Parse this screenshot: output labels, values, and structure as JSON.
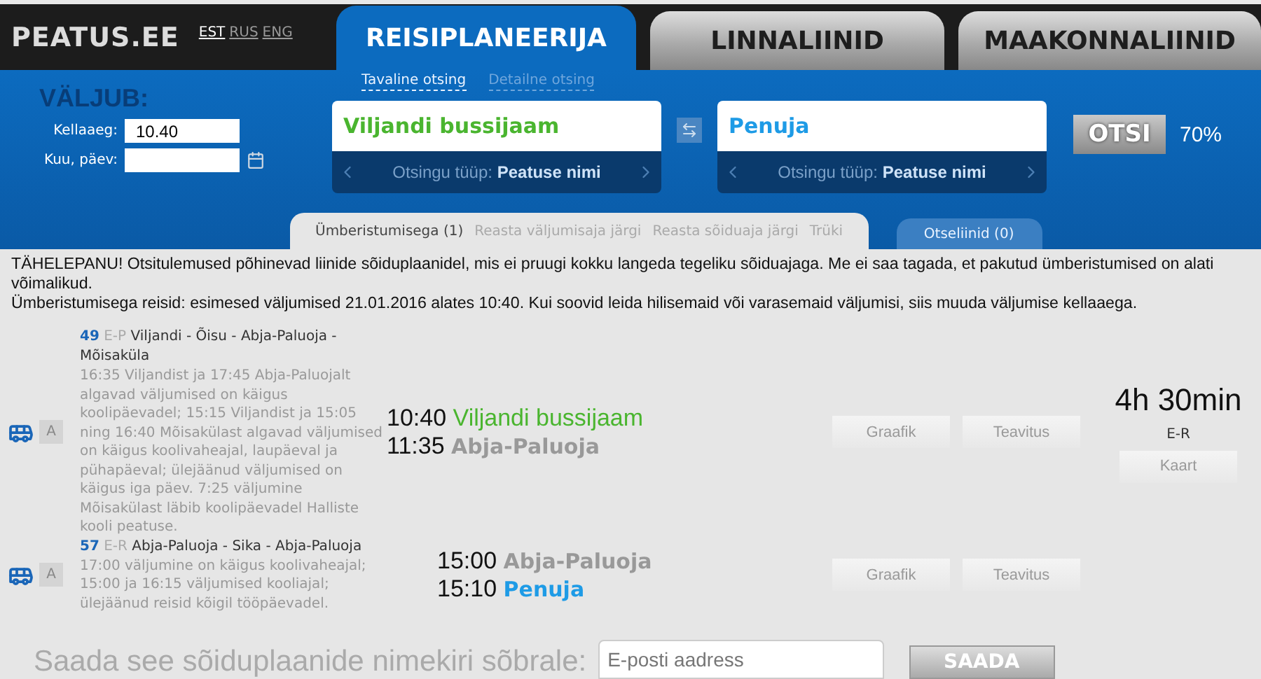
{
  "logo": "PEATUS.EE",
  "languages": [
    {
      "label": "EST",
      "selected": true
    },
    {
      "label": "RUS",
      "selected": false
    },
    {
      "label": "ENG",
      "selected": false
    }
  ],
  "main_tabs": [
    {
      "label": "REISIPLANEERIJA",
      "selected": true
    },
    {
      "label": "LINNALIINID",
      "selected": false
    },
    {
      "label": "MAAKONNALIINID",
      "selected": false
    }
  ],
  "search_modes": [
    {
      "label": "Tavaline otsing",
      "selected": true
    },
    {
      "label": "Detailne otsing",
      "selected": false
    }
  ],
  "departure": {
    "heading": "VÄLJUB:",
    "time_label": "Kellaaeg:",
    "time_value": "10.40",
    "date_label": "Kuu, päev:"
  },
  "from": {
    "value": "Viljandi bussijaam",
    "type_label": "Otsingu tüüp:",
    "type_value": "Peatuse nimi"
  },
  "to": {
    "value": "Penuja",
    "type_label": "Otsingu tüüp:",
    "type_value": "Peatuse nimi"
  },
  "search_button": "OTSI",
  "zoom": "70%",
  "result_tabs": [
    {
      "label": "Ümberistumisega (1)",
      "selected": true,
      "links": [
        "Reasta väljumisaja järgi",
        "Reasta sõiduaja järgi",
        "Trüki"
      ]
    },
    {
      "label": "Otseliinid (0)",
      "selected": false
    }
  ],
  "notice": [
    "TÄHELEPANU! Otsitulemused põhinevad liinide sõiduplaanidel, mis ei pruugi kokku langeda tegeliku sõiduajaga. Me ei saa tagada, et pakutud ümberistumised on alati võimalikud.",
    "Ümberistumisega reisid: esimesed väljumised 21.01.2016 alates 10:40. Kui soovid leida hilisemaid või varasemaid väljumisi, siis muuda väljumise kellaaega."
  ],
  "trips": [
    {
      "route_number": "49",
      "days": "E-P",
      "route_name": "Viljandi - Õisu - Abja-Paluoja - Mõisaküla",
      "badge": "A",
      "notes": "16:35 Viljandist ja 17:45 Abja-Paluojalt algavad väljumised on käigus koolipäevadel; 15:15 Viljandist ja 15:05 ning 16:40 Mõisakülast algavad väljumised on käigus koolivaheajal, laupäeval ja pühapäeval; ülejäänud väljumised on käigus iga päev. 7:25 väljumine Mõisakülast läbib koolipäevadel Halliste kooli peatuse.",
      "stops": [
        {
          "time": "10:40",
          "name": "Viljandi bussijaam",
          "kind": "origin"
        },
        {
          "time": "11:35",
          "name": "Abja-Paluoja",
          "kind": "transfer"
        }
      ],
      "buttons": [
        "Graafik",
        "Teavitus"
      ]
    },
    {
      "route_number": "57",
      "days": "E-R",
      "route_name": "Abja-Paluoja - Sika - Abja-Paluoja",
      "badge": "A",
      "notes": "17:00 väljumine on käigus koolivaheajal; 15:00 ja 16:15 väljumised kooliajal; ülejäänud reisid kõigil tööpäevadel.",
      "stops": [
        {
          "time": "15:00",
          "name": "Abja-Paluoja",
          "kind": "transfer"
        },
        {
          "time": "15:10",
          "name": "Penuja",
          "kind": "destination"
        }
      ],
      "buttons": [
        "Graafik",
        "Teavitus"
      ]
    }
  ],
  "summary": {
    "duration": "4h 30min",
    "days": "E-R",
    "map_button": "Kaart"
  },
  "share": {
    "label": "Saada see sõiduplaanide nimekiri sõbrale:",
    "placeholder": "E-posti aadress",
    "button": "SAADA"
  }
}
